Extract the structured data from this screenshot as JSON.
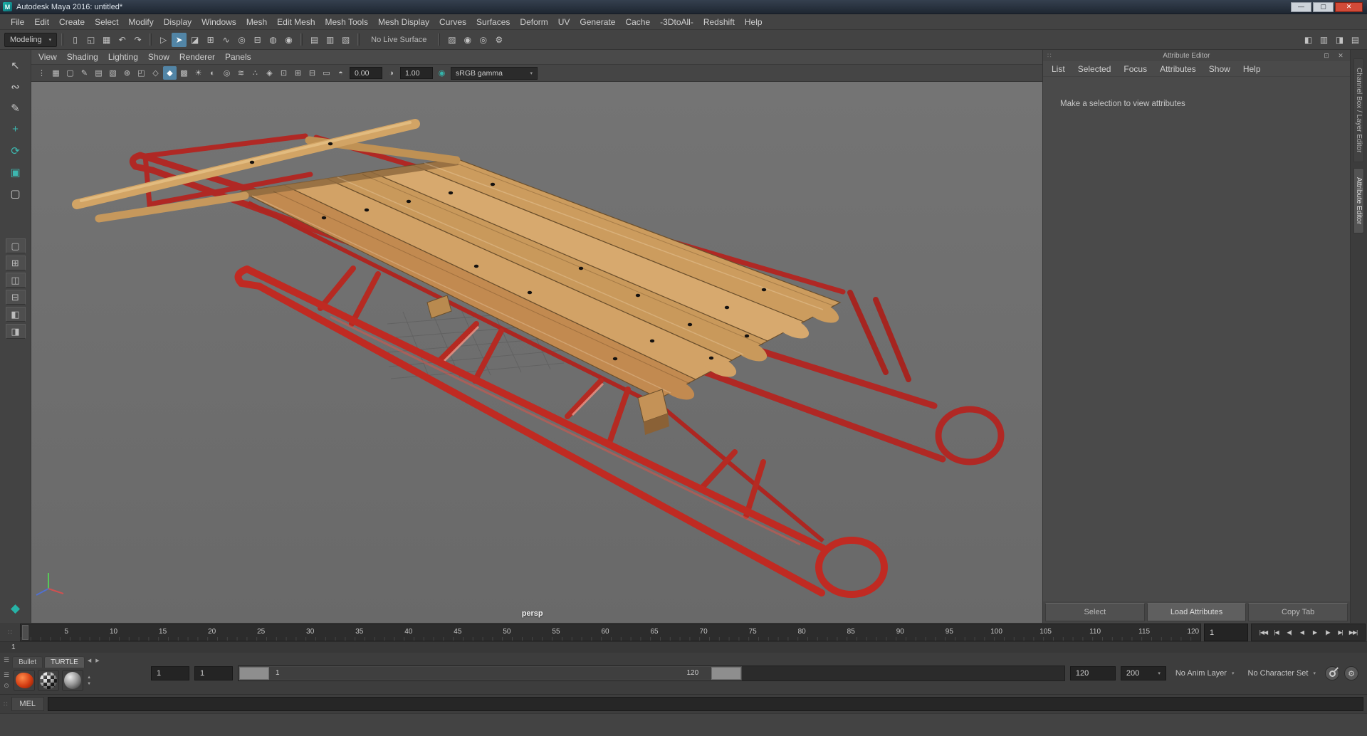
{
  "window": {
    "title": "Autodesk Maya 2016: untitled*",
    "app_icon": "M",
    "minimize": "—",
    "maximize": "▢",
    "close": "✕"
  },
  "menu_bar": [
    "File",
    "Edit",
    "Create",
    "Select",
    "Modify",
    "Display",
    "Windows",
    "Mesh",
    "Edit Mesh",
    "Mesh Tools",
    "Mesh Display",
    "Curves",
    "Surfaces",
    "Deform",
    "UV",
    "Generate",
    "Cache",
    "-3DtoAll-",
    "Redshift",
    "Help"
  ],
  "status_line": {
    "menu_set": "Modeling",
    "file_icons": [
      {
        "name": "new-scene-icon",
        "glyph": "▯"
      },
      {
        "name": "open-scene-icon",
        "glyph": "◱"
      },
      {
        "name": "save-scene-icon",
        "glyph": "▦"
      }
    ],
    "undo_icons": [
      {
        "name": "undo-icon",
        "glyph": "↶"
      },
      {
        "name": "redo-icon",
        "glyph": "↷"
      }
    ],
    "selection_icons": [
      {
        "name": "select-hierarchy-icon",
        "glyph": "▷"
      },
      {
        "name": "select-object-icon",
        "glyph": "➤",
        "active": true
      },
      {
        "name": "select-component-icon",
        "glyph": "◪"
      }
    ],
    "snap_icons": [
      {
        "name": "snap-grid-icon",
        "glyph": "⊞"
      },
      {
        "name": "snap-curve-icon",
        "glyph": "∿"
      },
      {
        "name": "snap-point-icon",
        "glyph": "◎"
      },
      {
        "name": "snap-plane-icon",
        "glyph": "⊟"
      },
      {
        "name": "snap-center-icon",
        "glyph": "◍"
      },
      {
        "name": "make-live-icon",
        "glyph": "◉"
      }
    ],
    "history_icons": [
      {
        "name": "input-connections-icon",
        "glyph": "▤"
      },
      {
        "name": "output-connections-icon",
        "glyph": "▥"
      },
      {
        "name": "construction-history-icon",
        "glyph": "▧"
      }
    ],
    "live_surface_label": "No Live Surface",
    "render_icons": [
      {
        "name": "open-render-view-icon",
        "glyph": "▨"
      },
      {
        "name": "render-frame-icon",
        "glyph": "◉"
      },
      {
        "name": "ipr-render-icon",
        "glyph": "◎"
      },
      {
        "name": "render-settings-icon",
        "glyph": "⚙"
      }
    ],
    "sidebar_icons": [
      {
        "name": "modeling-toolkit-toggle-icon",
        "glyph": "◧"
      },
      {
        "name": "tool-settings-toggle-icon",
        "glyph": "▥"
      },
      {
        "name": "attribute-editor-toggle-icon",
        "glyph": "◨"
      },
      {
        "name": "channel-box-toggle-icon",
        "glyph": "▤"
      }
    ]
  },
  "toolbox": {
    "tools": [
      {
        "name": "select-tool-icon",
        "glyph": "↖"
      },
      {
        "name": "lasso-tool-icon",
        "glyph": "∾"
      },
      {
        "name": "paint-select-tool-icon",
        "glyph": "✎"
      },
      {
        "name": "move-tool-icon",
        "glyph": "+",
        "teal": true
      },
      {
        "name": "rotate-tool-icon",
        "glyph": "⟳",
        "teal": true
      },
      {
        "name": "scale-tool-icon",
        "glyph": "▣",
        "teal": true
      },
      {
        "name": "marquee-tool-icon",
        "glyph": "▢"
      }
    ],
    "layouts": [
      {
        "name": "layout-single-pane-icon",
        "glyph": "▢"
      },
      {
        "name": "layout-four-pane-icon",
        "glyph": "⊞"
      },
      {
        "name": "layout-two-pane-side-icon",
        "glyph": "◫"
      },
      {
        "name": "layout-two-pane-stacked-icon",
        "glyph": "⊟"
      },
      {
        "name": "layout-three-pane-icon",
        "glyph": "◧"
      },
      {
        "name": "layout-outliner-icon",
        "glyph": "◨"
      }
    ],
    "bottom_glyph": "◆"
  },
  "viewport": {
    "menus": [
      "View",
      "Shading",
      "Lighting",
      "Show",
      "Renderer",
      "Panels"
    ],
    "bar_icons": [
      {
        "name": "panel-grip-icon",
        "glyph": "⋮"
      },
      {
        "name": "select-camera-icon",
        "glyph": "▦"
      },
      {
        "name": "camera-lock-icon",
        "glyph": "▢"
      },
      {
        "name": "camera-attributes-icon",
        "glyph": "✎"
      },
      {
        "name": "bookmarks-icon",
        "glyph": "▤"
      },
      {
        "name": "image-plane-icon",
        "glyph": "▧"
      },
      {
        "name": "pan-zoom-icon",
        "glyph": "⊕"
      },
      {
        "name": "overscan-icon",
        "glyph": "◰"
      },
      {
        "name": "wireframe-mode-icon",
        "glyph": "◇"
      },
      {
        "name": "smooth-shade-icon",
        "glyph": "◆",
        "active": true
      },
      {
        "name": "textured-mode-icon",
        "glyph": "▩"
      },
      {
        "name": "lights-icon",
        "glyph": "☀"
      },
      {
        "name": "shadows-icon",
        "glyph": "◐"
      },
      {
        "name": "occlusion-icon",
        "glyph": "◎"
      },
      {
        "name": "motion-blur-icon",
        "glyph": "≋"
      },
      {
        "name": "anti-alias-icon",
        "glyph": "∴"
      },
      {
        "name": "isolate-select-icon",
        "glyph": "◈"
      },
      {
        "name": "field-chart-icon",
        "glyph": "⊡"
      },
      {
        "name": "resolution-gate-icon",
        "glyph": "⊞"
      },
      {
        "name": "gate-mask-icon",
        "glyph": "⊟"
      },
      {
        "name": "safe-title-icon",
        "glyph": "▭"
      },
      {
        "name": "exposure-toggle-icon",
        "glyph": "◓"
      }
    ],
    "exposure": "0.00",
    "gamma_toggle_glyph": "◑",
    "gamma": "1.00",
    "view_transform_icon_glyph": "◉",
    "view_transform": "sRGB gamma",
    "camera_label": "persp"
  },
  "attribute_editor": {
    "title": "Attribute Editor",
    "menus": [
      "List",
      "Selected",
      "Focus",
      "Attributes",
      "Show",
      "Help"
    ],
    "message": "Make a selection to view attributes",
    "float_icon": "⊡",
    "close_icon": "✕",
    "select_button": "Select",
    "load_button": "Load Attributes",
    "copy_button": "Copy Tab"
  },
  "side_tabs": [
    {
      "name": "sidebar-tab-channel-box",
      "label": "Channel Box / Layer Editor"
    },
    {
      "name": "sidebar-tab-attribute-editor",
      "label": "Attribute Editor",
      "active": true
    }
  ],
  "timeline": {
    "ticks": [
      "5",
      "10",
      "15",
      "20",
      "25",
      "30",
      "35",
      "40",
      "45",
      "50",
      "55",
      "60",
      "65",
      "70",
      "75",
      "80",
      "85",
      "90",
      "95",
      "100",
      "105",
      "110",
      "115",
      "120"
    ],
    "current_frame": "1",
    "frame_readout": "1",
    "playback": [
      {
        "name": "go-to-start-button",
        "glyph": "|◀◀"
      },
      {
        "name": "step-back-key-button",
        "glyph": "|◀"
      },
      {
        "name": "step-back-frame-button",
        "glyph": "◀|"
      },
      {
        "name": "play-backward-button",
        "glyph": "◀"
      },
      {
        "name": "play-forward-button",
        "glyph": "▶"
      },
      {
        "name": "step-forward-frame-button",
        "glyph": "|▶"
      },
      {
        "name": "step-forward-key-button",
        "glyph": "▶|"
      },
      {
        "name": "go-to-end-button",
        "glyph": "▶▶|"
      }
    ]
  },
  "range_slider": {
    "anim_start": "1",
    "playback_start": "1",
    "range_start_label": "1",
    "range_end_label": "120",
    "playback_end": "120",
    "anim_end": "200",
    "anim_layer": "No Anim Layer",
    "character_set": "No Character Set"
  },
  "shelf": {
    "tabs": [
      {
        "name": "shelf-tab-bullet",
        "label": "Bullet"
      },
      {
        "name": "shelf-tab-turtle",
        "label": "TURTLE",
        "active": true
      }
    ],
    "prev_arrow": "◀",
    "next_arrow": "▶"
  },
  "command_line": {
    "label": "MEL",
    "value": ""
  },
  "ui": {
    "dropdown_arrow": "▾",
    "grip": "☰",
    "double_grip": "∷",
    "circle": "⊙",
    "up_arrow": "▲",
    "down_arrow": "▼",
    "gear": "⚙"
  },
  "colors": {
    "highlight_blue": "#5285a6",
    "viewport_gray": "#6e6e6e",
    "sled_red": "#c02a22",
    "sled_wood": "#cc9c5e",
    "titlebar_blue": "#232b36"
  }
}
